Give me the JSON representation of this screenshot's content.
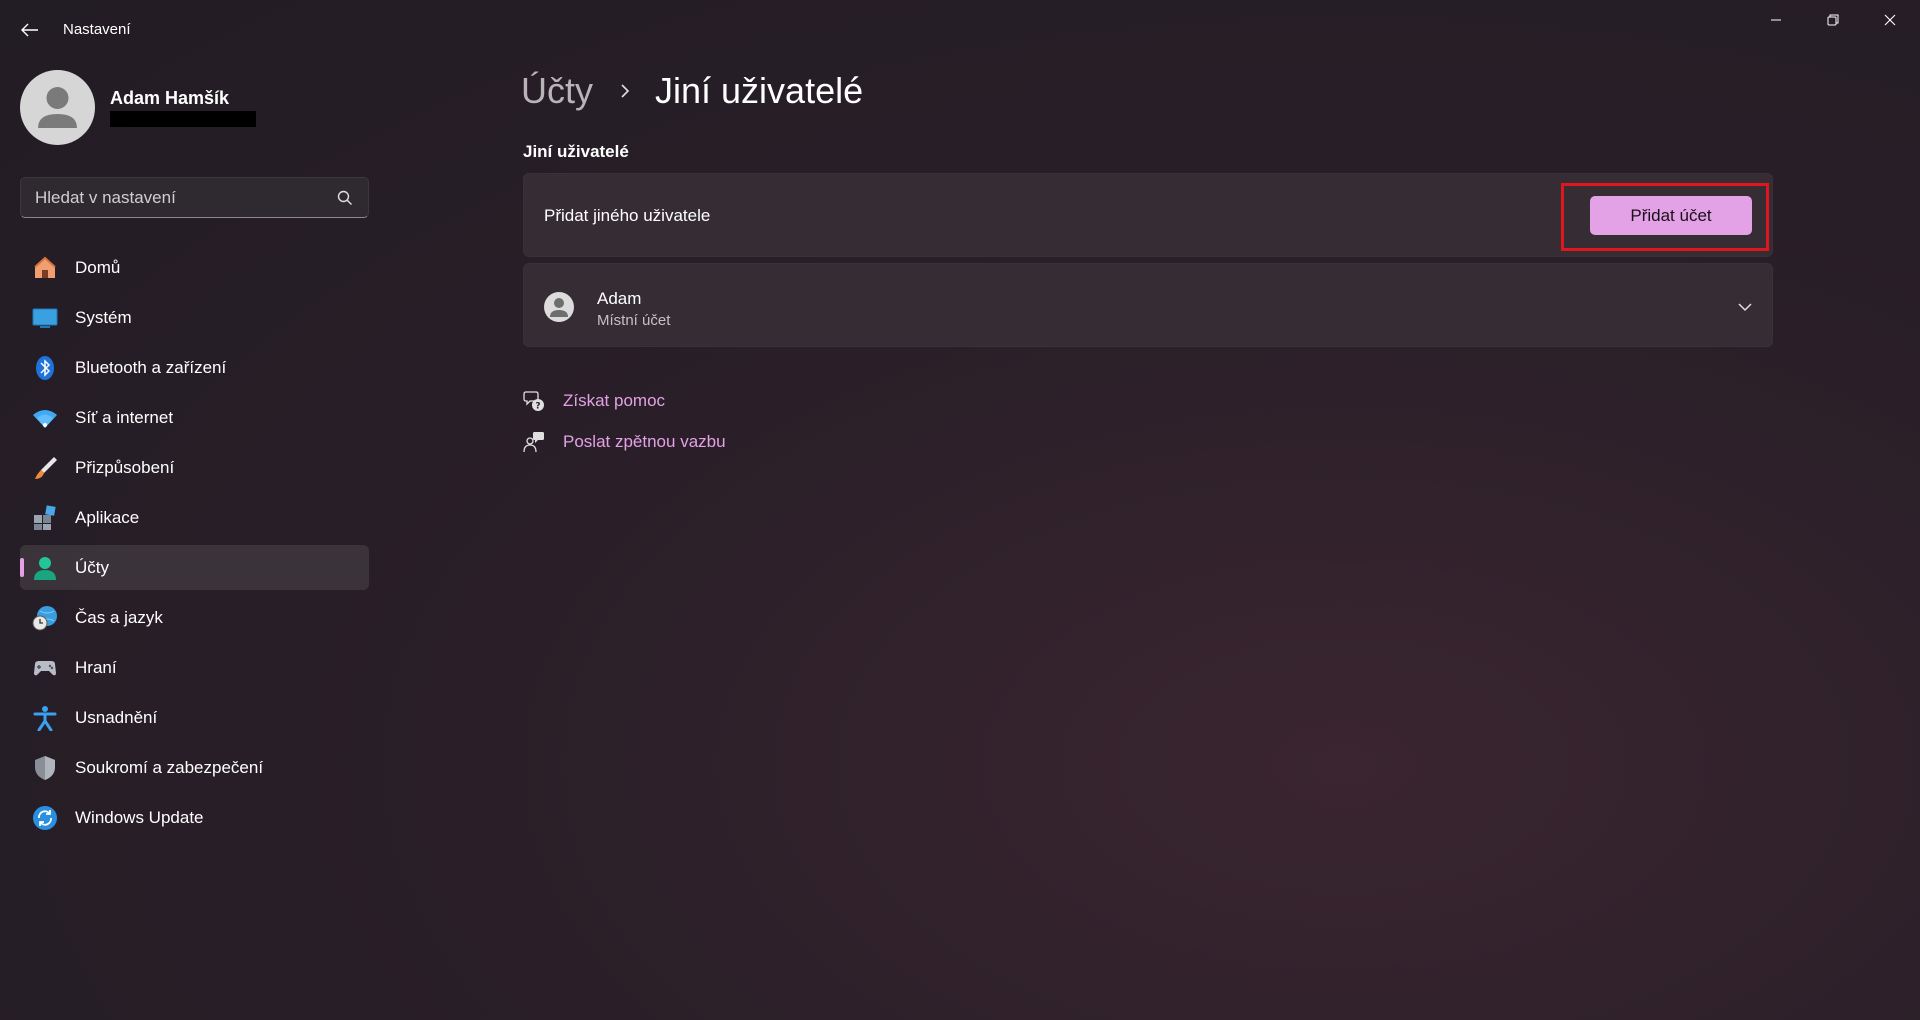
{
  "app": {
    "title": "Nastavení"
  },
  "profile": {
    "name": "Adam Hamšík"
  },
  "search": {
    "placeholder": "Hledat v nastavení"
  },
  "sidebar": {
    "items": [
      {
        "label": "Domů",
        "icon": "home-icon"
      },
      {
        "label": "Systém",
        "icon": "monitor-icon"
      },
      {
        "label": "Bluetooth a zařízení",
        "icon": "bluetooth-icon"
      },
      {
        "label": "Síť a internet",
        "icon": "wifi-icon"
      },
      {
        "label": "Přizpůsobení",
        "icon": "paintbrush-icon"
      },
      {
        "label": "Aplikace",
        "icon": "apps-icon"
      },
      {
        "label": "Účty",
        "icon": "account-icon",
        "active": true
      },
      {
        "label": "Čas a jazyk",
        "icon": "globe-clock-icon"
      },
      {
        "label": "Hraní",
        "icon": "gamepad-icon"
      },
      {
        "label": "Usnadnění",
        "icon": "accessibility-icon"
      },
      {
        "label": "Soukromí a zabezpečení",
        "icon": "shield-icon"
      },
      {
        "label": "Windows Update",
        "icon": "update-icon"
      }
    ]
  },
  "breadcrumb": {
    "parent": "Účty",
    "current": "Jiní uživatelé"
  },
  "section": {
    "title": "Jiní uživatelé"
  },
  "add_user": {
    "label": "Přidat jiného uživatele",
    "button_label": "Přidat účet"
  },
  "user": {
    "name": "Adam",
    "type": "Místní účet"
  },
  "links": {
    "help": "Získat pomoc",
    "feedback": "Poslat zpětnou vazbu"
  },
  "colors": {
    "accent": "#e3a1e6",
    "highlight": "#e0161f",
    "background": "#221c24"
  }
}
